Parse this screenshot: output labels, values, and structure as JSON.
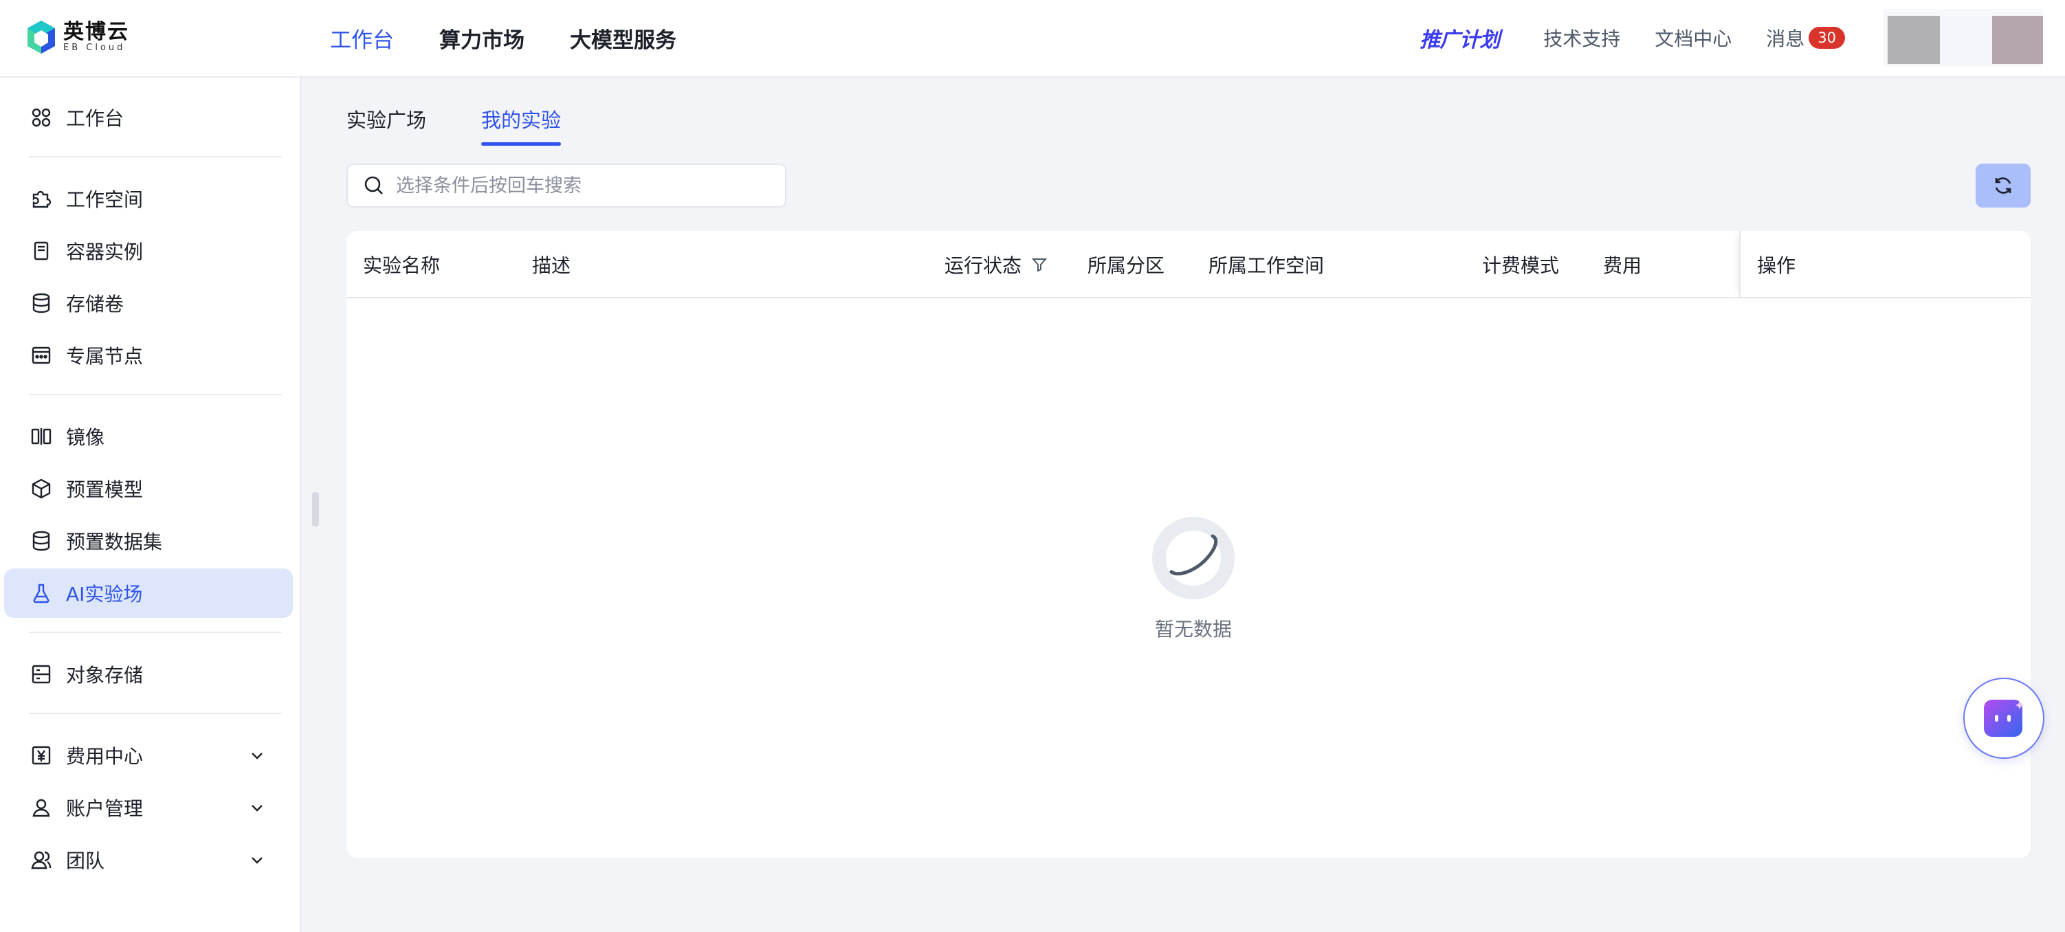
{
  "brand": {
    "name_cn": "英博云",
    "name_en": "EB Cloud"
  },
  "topnav": [
    {
      "label": "工作台",
      "active": true
    },
    {
      "label": "算力市场",
      "active": false
    },
    {
      "label": "大模型服务",
      "active": false
    }
  ],
  "topright": {
    "promo": "推广计划",
    "support": "技术支持",
    "docs": "文档中心",
    "messages": "消息",
    "message_count": "30"
  },
  "sidebar": {
    "items": [
      {
        "label": "工作台",
        "icon": "workbench-icon"
      },
      {
        "label": "工作空间",
        "icon": "puzzle-icon"
      },
      {
        "label": "容器实例",
        "icon": "container-icon"
      },
      {
        "label": "存储卷",
        "icon": "database-icon"
      },
      {
        "label": "专属节点",
        "icon": "node-icon"
      },
      {
        "label": "镜像",
        "icon": "mirror-icon"
      },
      {
        "label": "预置模型",
        "icon": "cube-icon"
      },
      {
        "label": "预置数据集",
        "icon": "dataset-icon"
      },
      {
        "label": "AI实验场",
        "icon": "flask-icon",
        "active": true
      },
      {
        "label": "对象存储",
        "icon": "storage-icon"
      },
      {
        "label": "费用中心",
        "icon": "yen-icon",
        "expandable": true
      },
      {
        "label": "账户管理",
        "icon": "user-icon",
        "expandable": true
      },
      {
        "label": "团队",
        "icon": "team-icon",
        "expandable": true
      }
    ]
  },
  "tabs": [
    {
      "label": "实验广场",
      "active": false
    },
    {
      "label": "我的实验",
      "active": true
    }
  ],
  "search": {
    "placeholder": "选择条件后按回车搜索",
    "value": ""
  },
  "table": {
    "columns": [
      "实验名称",
      "描述",
      "运行状态",
      "所属分区",
      "所属工作空间",
      "计费模式",
      "费用",
      "操作"
    ],
    "rows": [],
    "empty_text": "暂无数据"
  },
  "colors": {
    "accent": "#2f54eb",
    "active_bg": "#dde6fb",
    "badge": "#d9342b"
  }
}
